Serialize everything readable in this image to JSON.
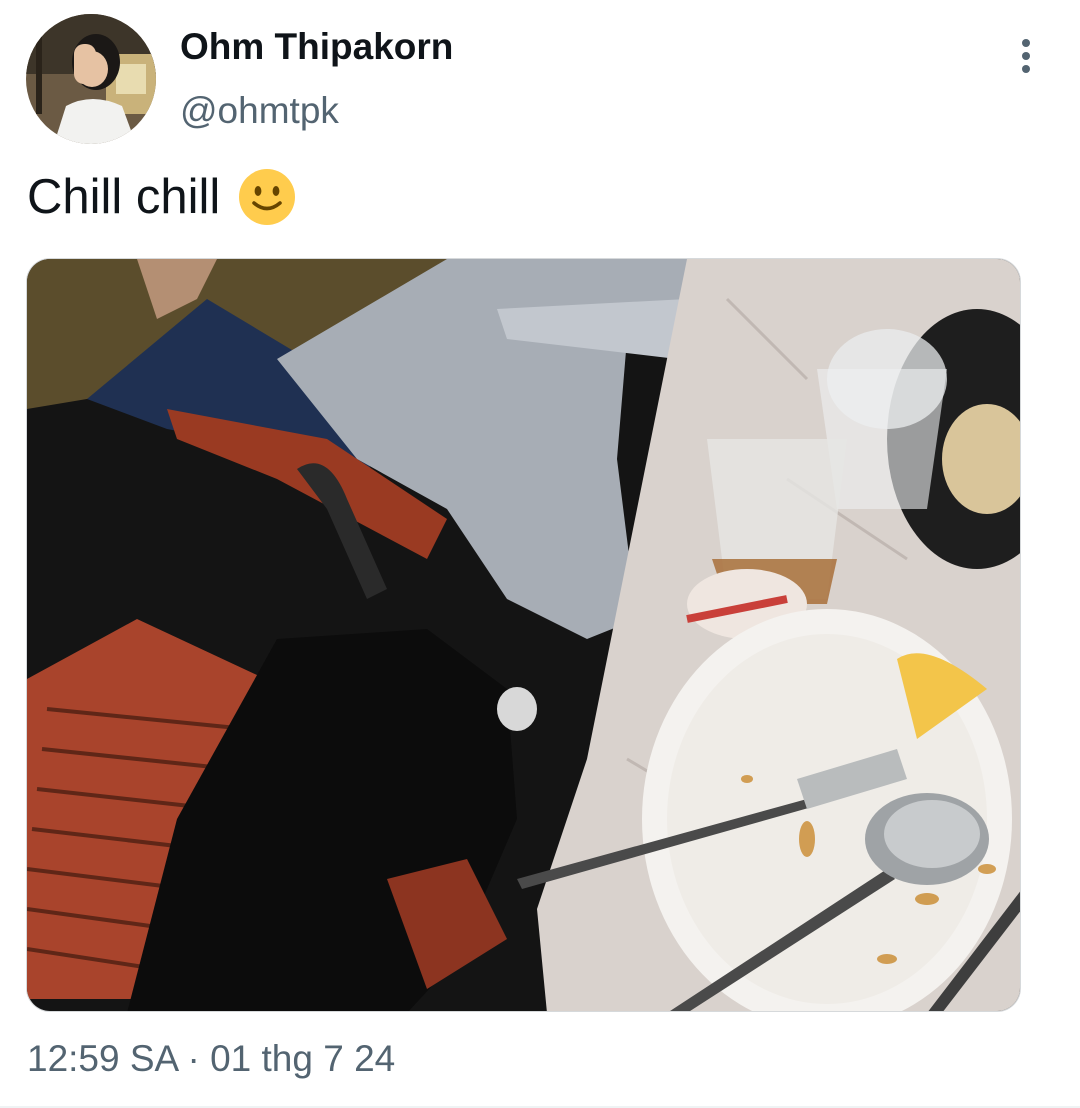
{
  "tweet": {
    "author": {
      "display_name": "Ohm Thipakorn",
      "handle": "@ohmtpk",
      "avatar_icon": "profile-photo"
    },
    "text": "Chill chill",
    "emoji": "slightly-smiling-face",
    "media_icon": "restaurant-table-photo",
    "timestamp": {
      "time": "12:59 SA",
      "separator": "·",
      "date": "01 thg 7 24"
    }
  },
  "icons": {
    "more": "vertical-ellipsis-icon"
  },
  "colors": {
    "primary_text": "#0f1419",
    "secondary_text": "#536471",
    "divider": "#eff3f4"
  }
}
